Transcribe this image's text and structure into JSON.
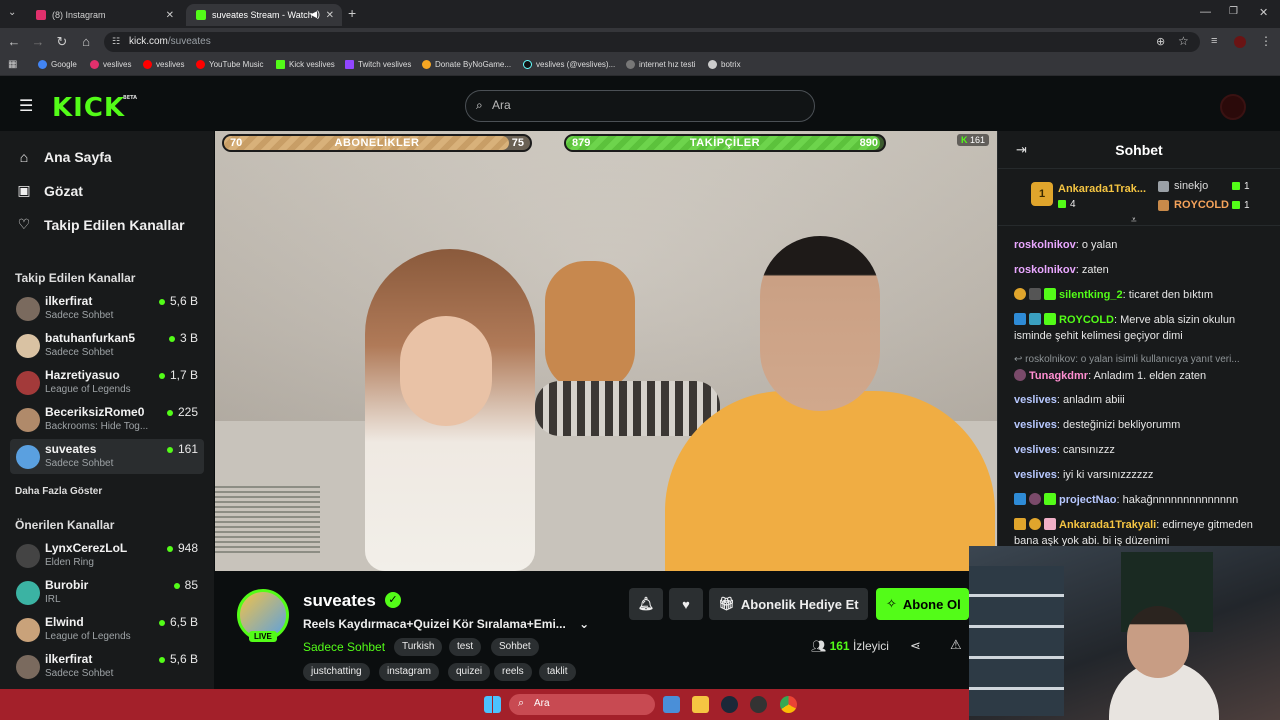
{
  "browser": {
    "tabs": [
      {
        "label": "(8) Instagram",
        "color": "#e1306c"
      },
      {
        "label": "suveates Stream - Watch Li",
        "color": "#53fc18"
      }
    ],
    "new_tab": "+",
    "url_host": "kick.com",
    "url_path": "/suveates",
    "bookmarks": [
      {
        "label": "Google",
        "color": "#4285f4"
      },
      {
        "label": "veslives",
        "color": "#e1306c"
      },
      {
        "label": "veslives",
        "color": "#ff0000"
      },
      {
        "label": "YouTube Music",
        "color": "#ff0000"
      },
      {
        "label": "Kick veslives",
        "color": "#53fc18"
      },
      {
        "label": "Twitch veslives",
        "color": "#9146ff"
      },
      {
        "label": "Donate ByNoGame...",
        "color": "#f5a623"
      },
      {
        "label": "veslives (@veslives)...",
        "color": "#111111"
      },
      {
        "label": "internet hız testi",
        "color": "#777777"
      },
      {
        "label": "botrix",
        "color": "#cccccc"
      }
    ]
  },
  "header": {
    "logo": "KICK",
    "logo_sup": "BETA",
    "search_placeholder": "Ara"
  },
  "sidebar": {
    "nav": [
      {
        "label": "Ana Sayfa",
        "icon": "⌂"
      },
      {
        "label": "Gözat",
        "icon": "▣"
      },
      {
        "label": "Takip Edilen Kanallar",
        "icon": "♡"
      }
    ],
    "followed_heading": "Takip Edilen Kanallar",
    "followed": [
      {
        "name": "ilkerfirat",
        "category": "Sadece Sohbet",
        "viewers": "5,6 B",
        "color": "#7a6a5e"
      },
      {
        "name": "batuhanfurkan5",
        "category": "Sadece Sohbet",
        "viewers": "3 B",
        "color": "#d9c2a3"
      },
      {
        "name": "Hazretiyasuo",
        "category": "League of Legends",
        "viewers": "1,7 B",
        "color": "#a33a3a"
      },
      {
        "name": "BeceriksizRome0",
        "category": "Backrooms: Hide Tog...",
        "viewers": "225",
        "color": "#b08a6a"
      },
      {
        "name": "suveates",
        "category": "Sadece Sohbet",
        "viewers": "161",
        "color": "#5aa0e0"
      }
    ],
    "show_more": "Daha Fazla Göster",
    "recommended_heading": "Önerilen Kanallar",
    "recommended": [
      {
        "name": "LynxCerezLoL",
        "category": "Elden Ring",
        "viewers": "948",
        "color": "#444444"
      },
      {
        "name": "Burobir",
        "category": "IRL",
        "viewers": "85",
        "color": "#3bb3a3"
      },
      {
        "name": "Elwind",
        "category": "League of Legends",
        "viewers": "6,5 B",
        "color": "#c9a27a"
      },
      {
        "name": "ilkerfirat",
        "category": "Sadece Sohbet",
        "viewers": "5,6 B",
        "color": "#7a6a5e"
      }
    ]
  },
  "overlay": {
    "subs": {
      "left": "70",
      "label": "ABONELİKLER",
      "right": "75",
      "progress": 0.933
    },
    "follows": {
      "left": "879",
      "label": "TAKİPÇİLER",
      "right": "890",
      "progress": 0.988
    },
    "viewer_mini": "161"
  },
  "stream": {
    "streamer": "suveates",
    "live": "LIVE",
    "title": "Reels Kaydırmaca+Quizei Kör Sıralama+Emi...",
    "category": "Sadece Sohbet",
    "tags_row1": [
      "Turkish",
      "test",
      "Sohbet"
    ],
    "tags_row2": [
      "justchatting",
      "instagram",
      "quizei",
      "reels",
      "taklit"
    ],
    "gift_label": "Abonelik Hediye Et",
    "subscribe_label": "Abone Ol",
    "viewers": "161",
    "viewers_label": "İzleyici"
  },
  "chat": {
    "title": "Sohbet",
    "leaderboard": {
      "top": {
        "name": "Ankarada1Trak...",
        "rank": "1",
        "gifts": "4"
      },
      "second": {
        "name": "sinekjo",
        "gifts": "1"
      },
      "third": {
        "name": "ROYCOLD",
        "gifts": "1"
      }
    },
    "messages": [
      {
        "user": "roskolnikov",
        "text": "o yalan",
        "color": "#e9a7ff"
      },
      {
        "user": "roskolnikov",
        "text": "zaten",
        "color": "#e9a7ff"
      },
      {
        "user": "silentking_2",
        "text": "ticaret den bıktım",
        "color": "#53fc18"
      },
      {
        "user": "ROYCOLD",
        "text": "Merve abla sizin okulun isminde şehit kelimesi geçiyor dimi",
        "color": "#53fc18"
      },
      {
        "user": "Tunagkdmr",
        "text": "Anladım 1. elden zaten",
        "color": "#ff8fd1"
      },
      {
        "user": "veslives",
        "text": "anladım abiii",
        "color": "#b7c8ff"
      },
      {
        "user": "veslives",
        "text": "desteğinizi bekliyorumm",
        "color": "#b7c8ff"
      },
      {
        "user": "veslives",
        "text": "cansınızzz",
        "color": "#b7c8ff"
      },
      {
        "user": "veslives",
        "text": "iyi ki varsınızzzzzz",
        "color": "#b7c8ff"
      },
      {
        "user": "projectNao",
        "text": "hakağnnnnnnnnnnnnnn",
        "color": "#b7c8ff"
      },
      {
        "user": "Ankarada1Trakyali",
        "text": "edirneye gitmeden bana aşk yok abi. bi iş düzenimi",
        "color": "#f5c542"
      }
    ],
    "reply_hint": "roskolnikov: o yalan isimli kullanıcıya yanıt veri..."
  },
  "taskbar": {
    "search_placeholder": "Ara"
  }
}
